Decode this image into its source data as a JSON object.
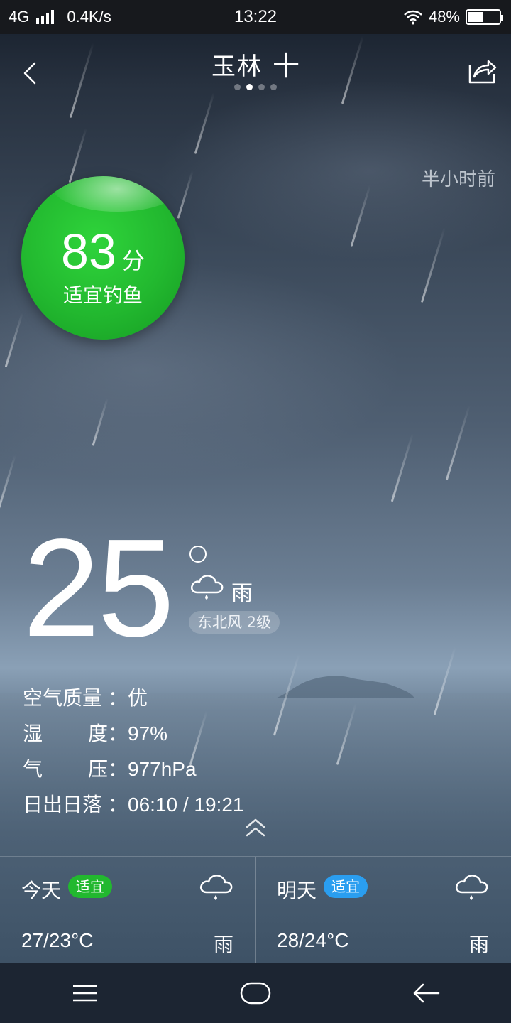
{
  "status_bar": {
    "network": "4G",
    "speed": "0.4K/s",
    "time": "13:22",
    "battery": "48%",
    "icons": [
      "signal-icon",
      "wifi-icon",
      "battery-icon"
    ]
  },
  "header": {
    "city": "玉林",
    "add_symbol": "十",
    "page_count": 4,
    "active_page": 1,
    "icons": [
      "back-arrow-icon",
      "share-icon"
    ]
  },
  "updated_text": "半小时前",
  "fishing_score": {
    "value": "83",
    "unit": "分",
    "label": "适宜钓鱼",
    "color": "#22b82f"
  },
  "current": {
    "temperature": "25",
    "condition": "雨",
    "condition_icon": "rain-cloud-icon",
    "wind": "东北风 2级"
  },
  "details": [
    {
      "label_a": "空气质量",
      "label_b": "",
      "value": "优"
    },
    {
      "label_a": "湿",
      "label_b": "度",
      "value": "97%"
    },
    {
      "label_a": "气",
      "label_b": "压",
      "value": "977hPa"
    },
    {
      "label_a": "日出日落",
      "label_b": "",
      "value": "06:10 / 19:21"
    }
  ],
  "colon": "：",
  "forecast": [
    {
      "day": "今天",
      "badge": "适宜",
      "badge_color": "#22b82f",
      "temp": "27/23°C",
      "condition": "雨",
      "icon": "rain-cloud-icon"
    },
    {
      "day": "明天",
      "badge": "适宜",
      "badge_color": "#2a9ef0",
      "temp": "28/24°C",
      "condition": "雨",
      "icon": "rain-cloud-icon"
    }
  ],
  "nav_icons": [
    "menu-icon",
    "home-icon",
    "back-icon"
  ]
}
